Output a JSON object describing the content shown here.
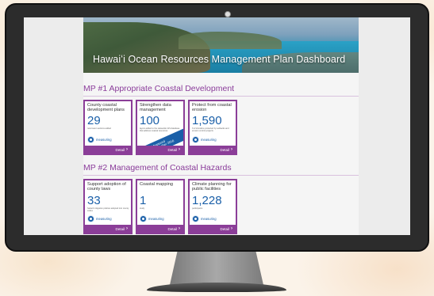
{
  "dashboard": {
    "title": "Hawaiʻi Ocean Resources Management Plan Dashboard"
  },
  "sections": [
    {
      "heading": "MP #1 Appropriate Coastal Development",
      "tiles": [
        {
          "title": "County coastal development plans",
          "value": "29",
          "desc": "new lower sections added",
          "status": "measuring",
          "detail": "Detail"
        },
        {
          "title": "Strengthen data management",
          "value": "100",
          "desc": "layers added to the statewide GIS database that address coastal resources",
          "status": "Measured",
          "status_date": "December 2016",
          "detail": "Detail"
        },
        {
          "title": "Protect from coastal erosion",
          "value": "1,590",
          "desc": "ft of shoreline protected by setbacks and erosion control projects",
          "status": "measuring",
          "detail": "Detail"
        }
      ]
    },
    {
      "heading": "MP #2 Management of Coastal Hazards",
      "tiles": [
        {
          "title": "Support adoption of county laws",
          "value": "33",
          "desc": "hazard mitigation policies adopted into county codes",
          "status": "measuring",
          "detail": "Detail"
        },
        {
          "title": "Coastal mapping",
          "value": "1",
          "desc": "study",
          "status": "measuring",
          "detail": "Detail"
        },
        {
          "title": "Climate planning for public facilities",
          "value": "1,228",
          "desc": "participants",
          "status": "measuring",
          "detail": "Detail"
        }
      ]
    }
  ],
  "colors": {
    "accent": "#8b3e98",
    "number": "#1a5fa8",
    "bezel": "#2c2c2c"
  }
}
